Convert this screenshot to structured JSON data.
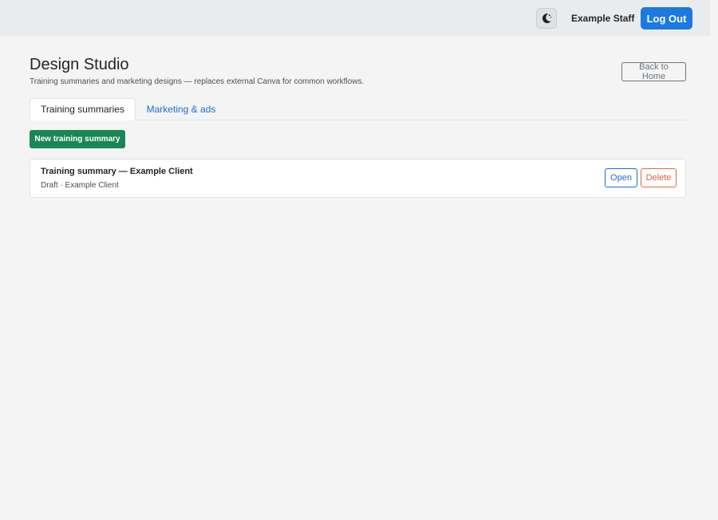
{
  "header": {
    "theme_toggle_icon": "moon-icon",
    "user_name": "Example Staff",
    "logout_label": "Log Out"
  },
  "page": {
    "title": "Design Studio",
    "subtitle": "Training summaries and marketing designs — replaces external Canva for common workflows.",
    "back_label": "Back to Home"
  },
  "tabs": [
    {
      "label": "Training summaries",
      "active": true
    },
    {
      "label": "Marketing & ads",
      "active": false
    }
  ],
  "actions": {
    "new_label": "New training summary"
  },
  "items": [
    {
      "title": "Training summary — Example Client",
      "meta": "Draft · Example Client",
      "open_label": "Open",
      "delete_label": "Delete"
    }
  ],
  "colors": {
    "primary": "#1b7ae0",
    "success": "#198754",
    "danger": "#d9643f",
    "topbar": "#e9ecef",
    "background": "#f4f4f4"
  }
}
